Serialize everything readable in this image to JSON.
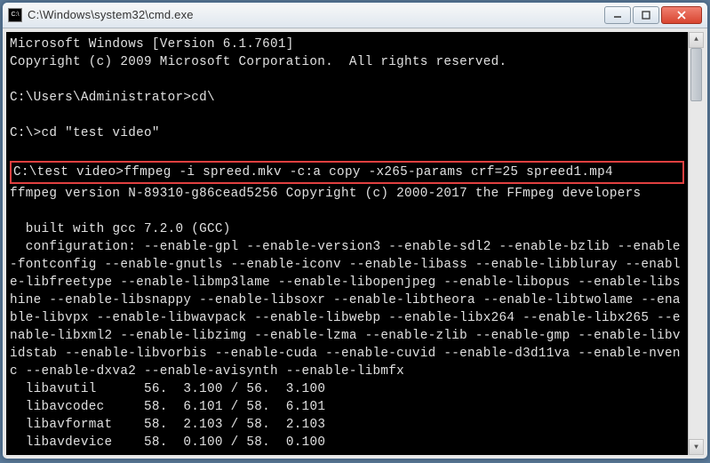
{
  "window": {
    "title": "C:\\Windows\\system32\\cmd.exe"
  },
  "terminal": {
    "line1": "Microsoft Windows [Version 6.1.7601]",
    "line2": "Copyright (c) 2009 Microsoft Corporation.  All rights reserved.",
    "prompt1": "C:\\Users\\Administrator>cd\\",
    "prompt2": "C:\\>cd \"test video\"",
    "highlighted_command": "C:\\test video>ffmpeg -i spreed.mkv -c:a copy -x265-params crf=25 spreed1.mp4",
    "ffmpeg_version": "ffmpeg version N-89310-g86cead5256 Copyright (c) 2000-2017 the FFmpeg developers",
    "built_with": "  built with gcc 7.2.0 (GCC)",
    "config": "  configuration: --enable-gpl --enable-version3 --enable-sdl2 --enable-bzlib --enable-fontconfig --enable-gnutls --enable-iconv --enable-libass --enable-libbluray --enable-libfreetype --enable-libmp3lame --enable-libopenjpeg --enable-libopus --enable-libshine --enable-libsnappy --enable-libsoxr --enable-libtheora --enable-libtwolame --enable-libvpx --enable-libwavpack --enable-libwebp --enable-libx264 --enable-libx265 --enable-libxml2 --enable-libzimg --enable-lzma --enable-zlib --enable-gmp --enable-libvidstab --enable-libvorbis --enable-cuda --enable-cuvid --enable-d3d11va --enable-nvenc --enable-dxva2 --enable-avisynth --enable-libmfx",
    "libs": [
      {
        "name": "libavutil",
        "ver": "56.  3.100 / 56.  3.100"
      },
      {
        "name": "libavcodec",
        "ver": "58.  6.101 / 58.  6.101"
      },
      {
        "name": "libavformat",
        "ver": "58.  2.103 / 58.  2.103"
      },
      {
        "name": "libavdevice",
        "ver": "58.  0.100 / 58.  0.100"
      }
    ]
  }
}
